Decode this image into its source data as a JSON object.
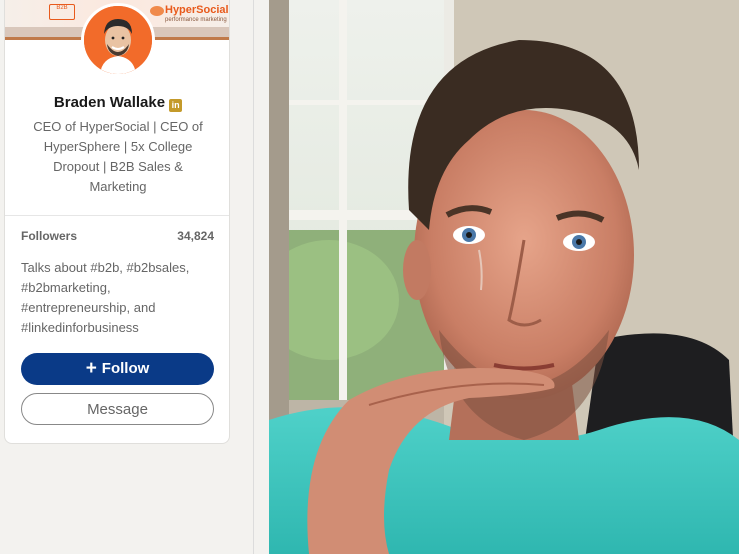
{
  "profile": {
    "banner_brand": "HyperSocial",
    "banner_tagline": "performance marketing",
    "banner_tag": "B2B",
    "name": "Braden Wallake",
    "badge": "in",
    "headline": "CEO of HyperSocial | CEO of HyperSphere | 5x College Dropout | B2B Sales & Marketing"
  },
  "stats": {
    "followers_label": "Followers",
    "followers_count": "34,824"
  },
  "talks_about": "Talks about #b2b, #b2bsales, #b2bmarketing, #entrepreneurship, and #linkedinforbusiness",
  "actions": {
    "follow_label": "Follow",
    "message_label": "Message"
  },
  "colors": {
    "accent": "#0a3a87",
    "brand_orange": "#f26b2a",
    "shirt_teal": "#3ec7c0"
  },
  "post_image": {
    "subject": "crying-selfie"
  }
}
